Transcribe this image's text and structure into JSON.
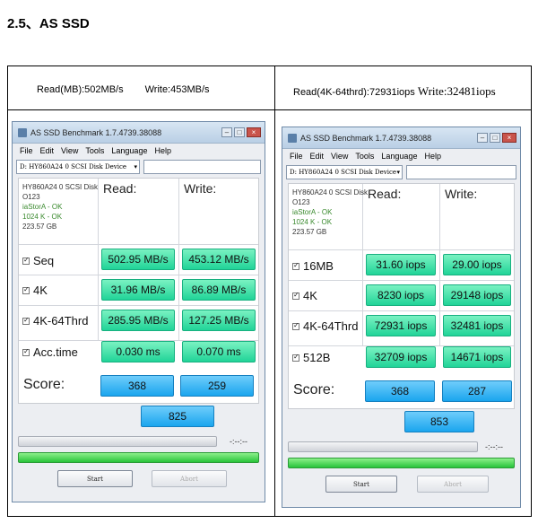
{
  "heading": "2.5、AS SSD",
  "captions": {
    "left_read": "Read(MB):502MB/s",
    "left_write": "Write:453MB/s",
    "right_read": "Read(4K-64thrd):72931iops",
    "right_write": "Write:32481iops"
  },
  "windows": [
    {
      "title": "AS SSD Benchmark 1.7.4739.38088",
      "menu": [
        "File",
        "Edit",
        "View",
        "Tools",
        "Language",
        "Help"
      ],
      "device": "D: HY860A24 0 SCSI Disk Device",
      "disk_info": {
        "model": "HY860A24 0 SCSI Disk",
        "fw": "O123",
        "driver": "iaStorA - OK",
        "align": "1024 K - OK",
        "size": "223.57 GB"
      },
      "col_read": "Read:",
      "col_write": "Write:",
      "rows": [
        {
          "label": "Seq",
          "read": "502.95 MB/s",
          "write": "453.12 MB/s"
        },
        {
          "label": "4K",
          "read": "31.96 MB/s",
          "write": "86.89 MB/s"
        },
        {
          "label": "4K-64Thrd",
          "read": "285.95 MB/s",
          "write": "127.25 MB/s"
        },
        {
          "label": "Acc.time",
          "read": "0.030 ms",
          "write": "0.070 ms"
        }
      ],
      "score_label": "Score:",
      "score_read": "368",
      "score_write": "259",
      "score_total": "825",
      "time": "-:--:--",
      "start": "Start",
      "abort": "Abort"
    },
    {
      "title": "AS SSD Benchmark 1.7.4739.38088",
      "menu": [
        "File",
        "Edit",
        "View",
        "Tools",
        "Language",
        "Help"
      ],
      "device": "D: HY860A24 0 SCSI Disk Device",
      "disk_info": {
        "model": "HY860A24 0 SCSI Disk",
        "fw": "O123",
        "driver": "iaStorA - OK",
        "align": "1024 K - OK",
        "size": "223.57 GB"
      },
      "col_read": "Read:",
      "col_write": "Write:",
      "rows": [
        {
          "label": "16MB",
          "read": "31.60 iops",
          "write": "29.00 iops"
        },
        {
          "label": "4K",
          "read": "8230 iops",
          "write": "29148 iops"
        },
        {
          "label": "4K-64Thrd",
          "read": "72931 iops",
          "write": "32481 iops"
        },
        {
          "label": "512B",
          "read": "32709 iops",
          "write": "14671 iops"
        }
      ],
      "score_label": "Score:",
      "score_read": "368",
      "score_write": "287",
      "score_total": "853",
      "time": "-:--:--",
      "start": "Start",
      "abort": "Abort"
    }
  ]
}
